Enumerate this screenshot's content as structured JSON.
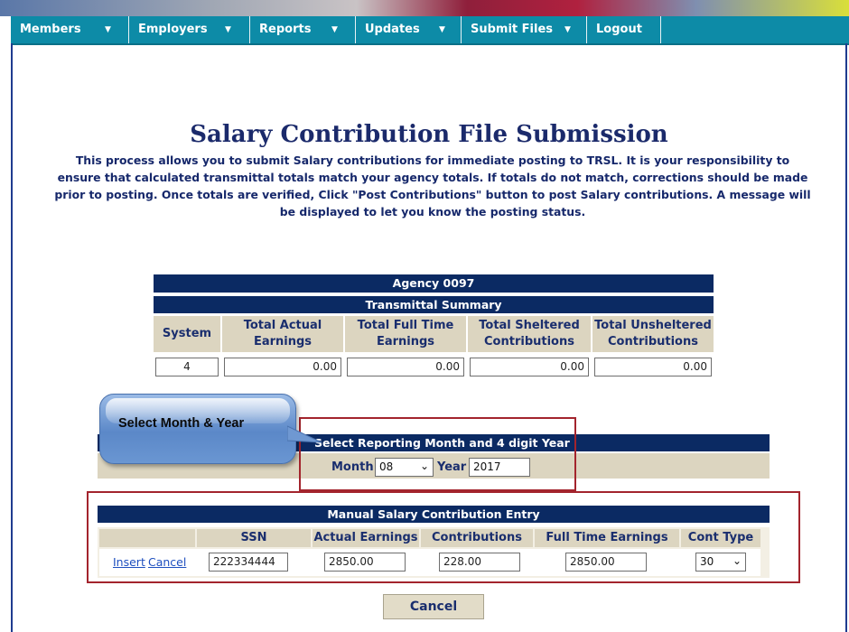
{
  "nav": {
    "members": "Members",
    "employers": "Employers",
    "reports": "Reports",
    "updates": "Updates",
    "submit_files": "Submit Files",
    "logout": "Logout",
    "caret": "▼"
  },
  "page": {
    "title": "Salary Contribution File Submission",
    "description": "This process allows you to submit Salary contributions for immediate posting to TRSL. It is your responsibility to ensure that calculated transmittal totals match your agency totals. If totals do not match, corrections should be made prior to posting. Once totals are verified, Click \"Post Contributions\" button to post Salary contributions. A message will be displayed to let you know the posting status."
  },
  "summary": {
    "agency": "Agency 0097",
    "subtitle": "Transmittal Summary",
    "headers": {
      "system": "System",
      "actual": "Total Actual Earnings",
      "fulltime": "Total Full Time Earnings",
      "sheltered": "Total Sheltered Contributions",
      "unsheltered": "Total Unsheltered Contributions"
    },
    "values": {
      "system": "4",
      "actual": "0.00",
      "fulltime": "0.00",
      "sheltered": "0.00",
      "unsheltered": "0.00"
    }
  },
  "callout": {
    "text": "Select Month & Year"
  },
  "period": {
    "header": "Select Reporting Month and 4 digit Year",
    "month_label": "Month",
    "month_value": "08",
    "year_label": "Year",
    "year_value": "2017"
  },
  "manual": {
    "header": "Manual Salary Contribution Entry",
    "columns": {
      "ssn": "SSN",
      "actual": "Actual Earnings",
      "contributions": "Contributions",
      "fulltime": "Full Time Earnings",
      "conttype": "Cont Type"
    },
    "row": {
      "insert": "Insert",
      "cancel": "Cancel",
      "ssn": "222334444",
      "actual": "2850.00",
      "contributions": "228.00",
      "fulltime": "2850.00",
      "conttype": "30"
    }
  },
  "footer": {
    "cancel_button": "Cancel"
  },
  "colors": {
    "navbar": "#0d8ba7",
    "table_header": "#0b2a63",
    "column_header": "#dcd5c0",
    "highlight_border": "#a3242d",
    "title": "#1b2a6b"
  }
}
